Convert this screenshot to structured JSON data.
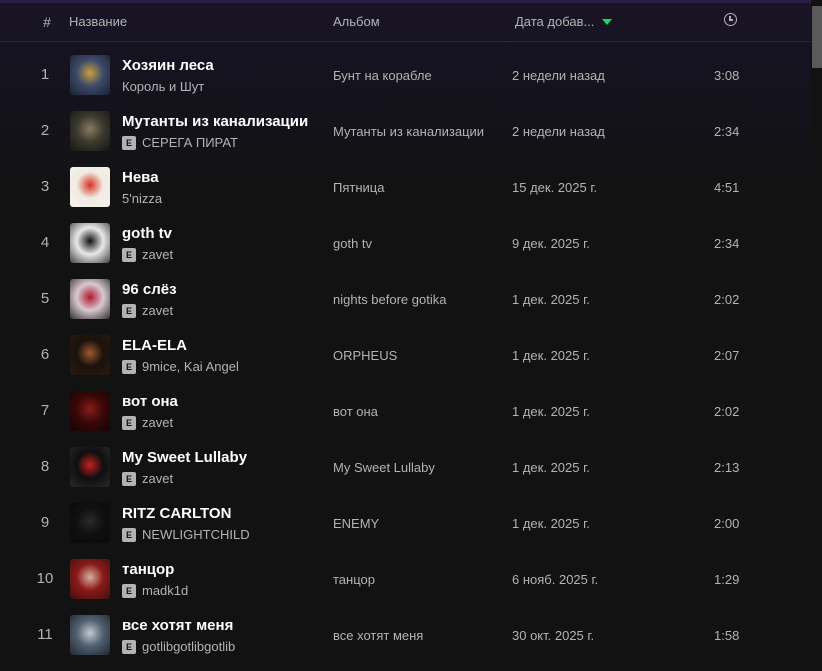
{
  "header": {
    "num": "#",
    "title": "Название",
    "album": "Альбом",
    "date": "Дата добав...",
    "duration_icon": "clock-icon",
    "sort_indicator": "sort-descending-icon"
  },
  "colors": {
    "accent": "#1ed760",
    "background": "#121212",
    "title_text": "#ffffff",
    "secondary_text": "#b3b3b3"
  },
  "tracks": [
    {
      "num": "1",
      "title": "Хозяин леса",
      "artist": "Король и Шут",
      "explicit": false,
      "album": "Бунт на корабле",
      "date": "2 недели назад",
      "duration": "3:08",
      "cover": [
        "#3d4a6a",
        "#c8a040",
        "#1a2030"
      ]
    },
    {
      "num": "2",
      "title": "Мутанты из канализации",
      "artist": "СЕРЕГА ПИРАТ",
      "explicit": true,
      "album": "Мутанты из канализации",
      "date": "2 недели назад",
      "duration": "2:34",
      "cover": [
        "#3b3a2e",
        "#8a7a60",
        "#151512"
      ]
    },
    {
      "num": "3",
      "title": "Нева",
      "artist": "5'nizza",
      "explicit": false,
      "album": "Пятница",
      "date": "15 дек. 2025 г.",
      "duration": "4:51",
      "cover": [
        "#f0ece4",
        "#d8321e",
        "#f5f2ec"
      ]
    },
    {
      "num": "4",
      "title": "goth tv",
      "artist": "zavet",
      "explicit": true,
      "album": "goth tv",
      "date": "9 дек. 2025 г.",
      "duration": "2:34",
      "cover": [
        "#e8e8e8",
        "#101010",
        "#404040"
      ]
    },
    {
      "num": "5",
      "title": "96 слёз",
      "artist": "zavet",
      "explicit": true,
      "album": "nights before gotika",
      "date": "1 дек. 2025 г.",
      "duration": "2:02",
      "cover": [
        "#d8c8d0",
        "#b01830",
        "#303030"
      ]
    },
    {
      "num": "6",
      "title": "ELA-ELA",
      "artist": "9mice, Kai Angel",
      "explicit": true,
      "album": "ORPHEUS",
      "date": "1 дек. 2025 г.",
      "duration": "2:07",
      "cover": [
        "#1a120c",
        "#9a5a30",
        "#2a1a10"
      ]
    },
    {
      "num": "7",
      "title": "вот она",
      "artist": "zavet",
      "explicit": true,
      "album": "вот она",
      "date": "1 дек. 2025 г.",
      "duration": "2:02",
      "cover": [
        "#3a0808",
        "#8c1a1a",
        "#150303"
      ]
    },
    {
      "num": "8",
      "title": "My Sweet Lullaby",
      "artist": "zavet",
      "explicit": true,
      "album": "My Sweet Lullaby",
      "date": "1 дек. 2025 г.",
      "duration": "2:13",
      "cover": [
        "#0e0e0e",
        "#c82020",
        "#2a2a2a"
      ]
    },
    {
      "num": "9",
      "title": "RITZ CARLTON",
      "artist": "NEWLIGHTCHILD",
      "explicit": true,
      "album": "ENEMY",
      "date": "1 дек. 2025 г.",
      "duration": "2:00",
      "cover": [
        "#101010",
        "#2a2a2a",
        "#0a0a0a"
      ]
    },
    {
      "num": "10",
      "title": "танцор",
      "artist": "madk1d",
      "explicit": true,
      "album": "танцор",
      "date": "6 нояб. 2025 г.",
      "duration": "1:29",
      "cover": [
        "#8a1a18",
        "#d8b0a0",
        "#401010"
      ]
    },
    {
      "num": "11",
      "title": "все хотят меня",
      "artist": "gotlibgotlibgotlib",
      "explicit": true,
      "album": "все хотят меня",
      "date": "30 окт. 2025 г.",
      "duration": "1:58",
      "cover": [
        "#506070",
        "#c0c8d0",
        "#20262e"
      ]
    }
  ]
}
